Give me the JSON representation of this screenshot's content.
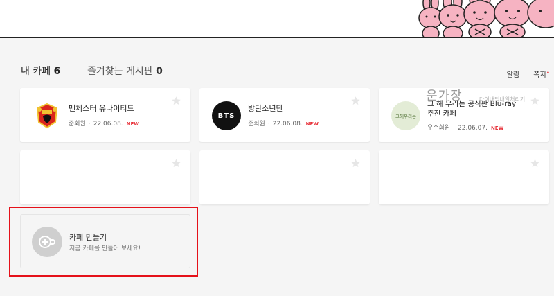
{
  "header": {
    "my_cafe_label": "내 카페",
    "my_cafe_count": "6",
    "fav_board_label": "즐겨찾는 게시판",
    "fav_board_count": "0",
    "alarm_label": "알림",
    "note_label": "쪽지",
    "note_dot": "•"
  },
  "cafes": [
    {
      "name": "맨체스터 유나이티드",
      "grade": "준회원",
      "date": "22.06.08.",
      "badge": "NEW",
      "logo_text": ""
    },
    {
      "name": "방탄소년단",
      "grade": "준회원",
      "date": "22.06.08.",
      "badge": "NEW",
      "logo_text": "BTS"
    },
    {
      "name": "그 해 우리는 공식판 Blu-ray 추진 카페",
      "grade": "우수회원",
      "date": "22.06.07.",
      "badge": "NEW",
      "logo_text": "그해우리는"
    }
  ],
  "make_cafe": {
    "title": "카페 만들기",
    "subtitle": "지금 카페를 만들어 보세요!"
  },
  "watermark": {
    "text": "운가장",
    "small": "다이내믹내일처리기"
  },
  "colors": {
    "accent_red": "#e8343c",
    "highlight_red": "#e5111a",
    "background": "#f5f5f5",
    "mascot_pink": "#f6b3c2"
  },
  "icons": {
    "star": "star-icon",
    "cafe_add": "cup-plus-icon",
    "mascots": "pink-rabbit-mascot-icons"
  }
}
